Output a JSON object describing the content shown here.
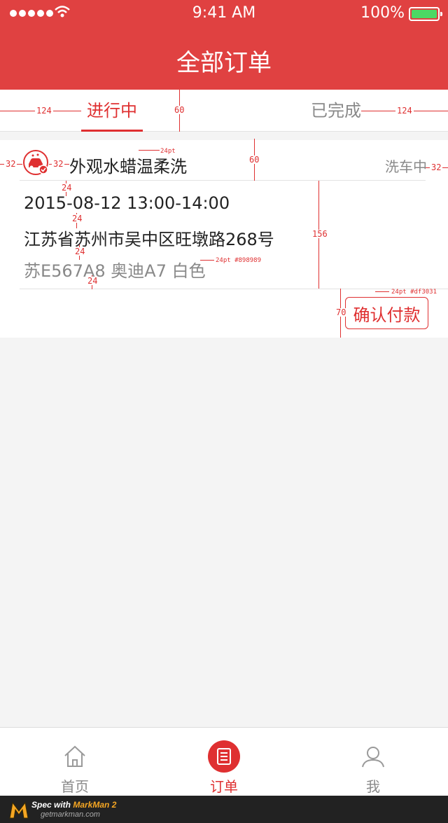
{
  "status_bar": {
    "time": "9:41 AM",
    "battery": "100%",
    "battery_level": 1.0
  },
  "header": {
    "title": "全部订单"
  },
  "tabs": [
    {
      "label": "进行中",
      "active": true
    },
    {
      "label": "已完成",
      "active": false
    }
  ],
  "order": {
    "service": "外观水蜡温柔洗",
    "status": "洗车中",
    "datetime": "2015-08-12 13:00-14:00",
    "address": "江苏省苏州市吴中区旺墩路268号",
    "car": "苏E567A8 奥迪A7 白色",
    "action_label": "确认付款"
  },
  "annotations": {
    "tab_left_gap": "124",
    "tab_right_gap": "124",
    "tab_height": "60",
    "icon_left": "32",
    "icon_right": "32",
    "status_right": "32",
    "title_font": "24pt",
    "head_height": "60",
    "spacing_1": "24",
    "spacing_2": "24",
    "spacing_3": "24",
    "spacing_4": "24",
    "body_height": "156",
    "car_font": "24pt #898989",
    "button_height": "70",
    "button_font": "24pt #df3031"
  },
  "tabbar": [
    {
      "label": "首页",
      "icon": "home-icon",
      "active": false
    },
    {
      "label": "订单",
      "icon": "orders-icon",
      "active": true
    },
    {
      "label": "我",
      "icon": "profile-icon",
      "active": false
    }
  ],
  "footer": {
    "prefix": "Spec with ",
    "brand": "MarkMan 2",
    "site": "getmarkman.com"
  },
  "colors": {
    "primary": "#e04141",
    "accent": "#df3031",
    "muted": "#898989",
    "background": "#f4f4f4"
  }
}
